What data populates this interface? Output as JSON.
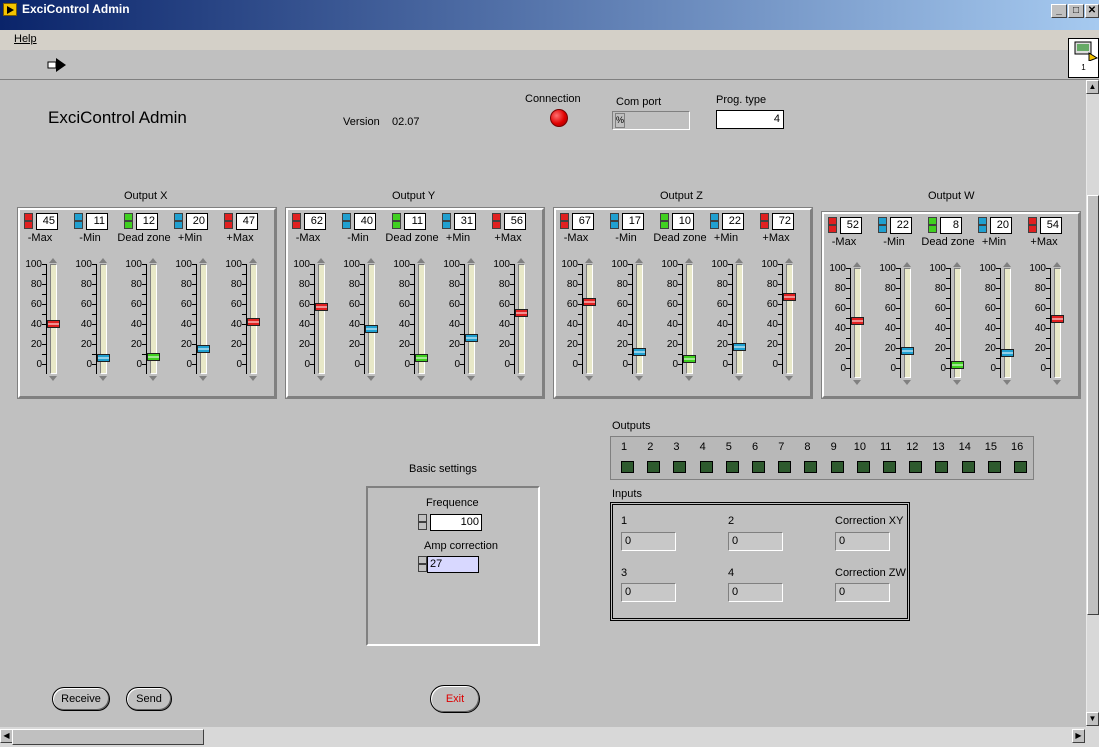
{
  "window": {
    "title": "ExciControl Admin",
    "minimize": "_",
    "maximize": "□",
    "close": "✕"
  },
  "menu": {
    "help": "Help"
  },
  "labview_icon_text": "1",
  "header": {
    "app_title": "ExciControl Admin",
    "version_label": "Version",
    "version_value": "02.07",
    "connection_label": "Connection",
    "com_port_label": "Com port",
    "com_port_value": "",
    "prog_type_label": "Prog. type",
    "prog_type_value": "4"
  },
  "slider_scale": [
    "100",
    "80",
    "60",
    "40",
    "20",
    "0"
  ],
  "slider_labels": [
    "-Max",
    "-Min",
    "Dead zone",
    "+Min",
    "+Max"
  ],
  "slider_colors": [
    "#e02020",
    "#20a0d0",
    "#40d020",
    "#20a0d0",
    "#e02020"
  ],
  "outputs": [
    {
      "title": "Output X",
      "values": [
        "45",
        "11",
        "12",
        "20",
        "47"
      ],
      "levels": [
        45,
        11,
        12,
        20,
        47
      ]
    },
    {
      "title": "Output Y",
      "values": [
        "62",
        "40",
        "11",
        "31",
        "56"
      ],
      "levels": [
        62,
        40,
        11,
        31,
        56
      ]
    },
    {
      "title": "Output Z",
      "values": [
        "67",
        "17",
        "10",
        "22",
        "72"
      ],
      "levels": [
        67,
        17,
        10,
        22,
        72
      ]
    },
    {
      "title": "Output W",
      "values": [
        "52",
        "22",
        "8",
        "20",
        "54"
      ],
      "levels": [
        52,
        22,
        8,
        20,
        54
      ]
    }
  ],
  "outputs_panel": {
    "label": "Outputs",
    "numbers": [
      "1",
      "2",
      "3",
      "4",
      "5",
      "6",
      "7",
      "8",
      "9",
      "10",
      "11",
      "12",
      "13",
      "14",
      "15",
      "16"
    ]
  },
  "inputs_panel": {
    "label": "Inputs",
    "fields": [
      {
        "label": "1",
        "value": "0"
      },
      {
        "label": "2",
        "value": "0"
      },
      {
        "label": "Correction XY",
        "value": "0"
      },
      {
        "label": "3",
        "value": "0"
      },
      {
        "label": "4",
        "value": "0"
      },
      {
        "label": "Correction ZW",
        "value": "0"
      }
    ]
  },
  "basic_settings": {
    "title": "Basic settings",
    "frequence_label": "Frequence",
    "frequence_value": "100",
    "amp_label": "Amp correction",
    "amp_value": "27"
  },
  "buttons": {
    "receive": "Receive",
    "send": "Send",
    "exit": "Exit"
  }
}
